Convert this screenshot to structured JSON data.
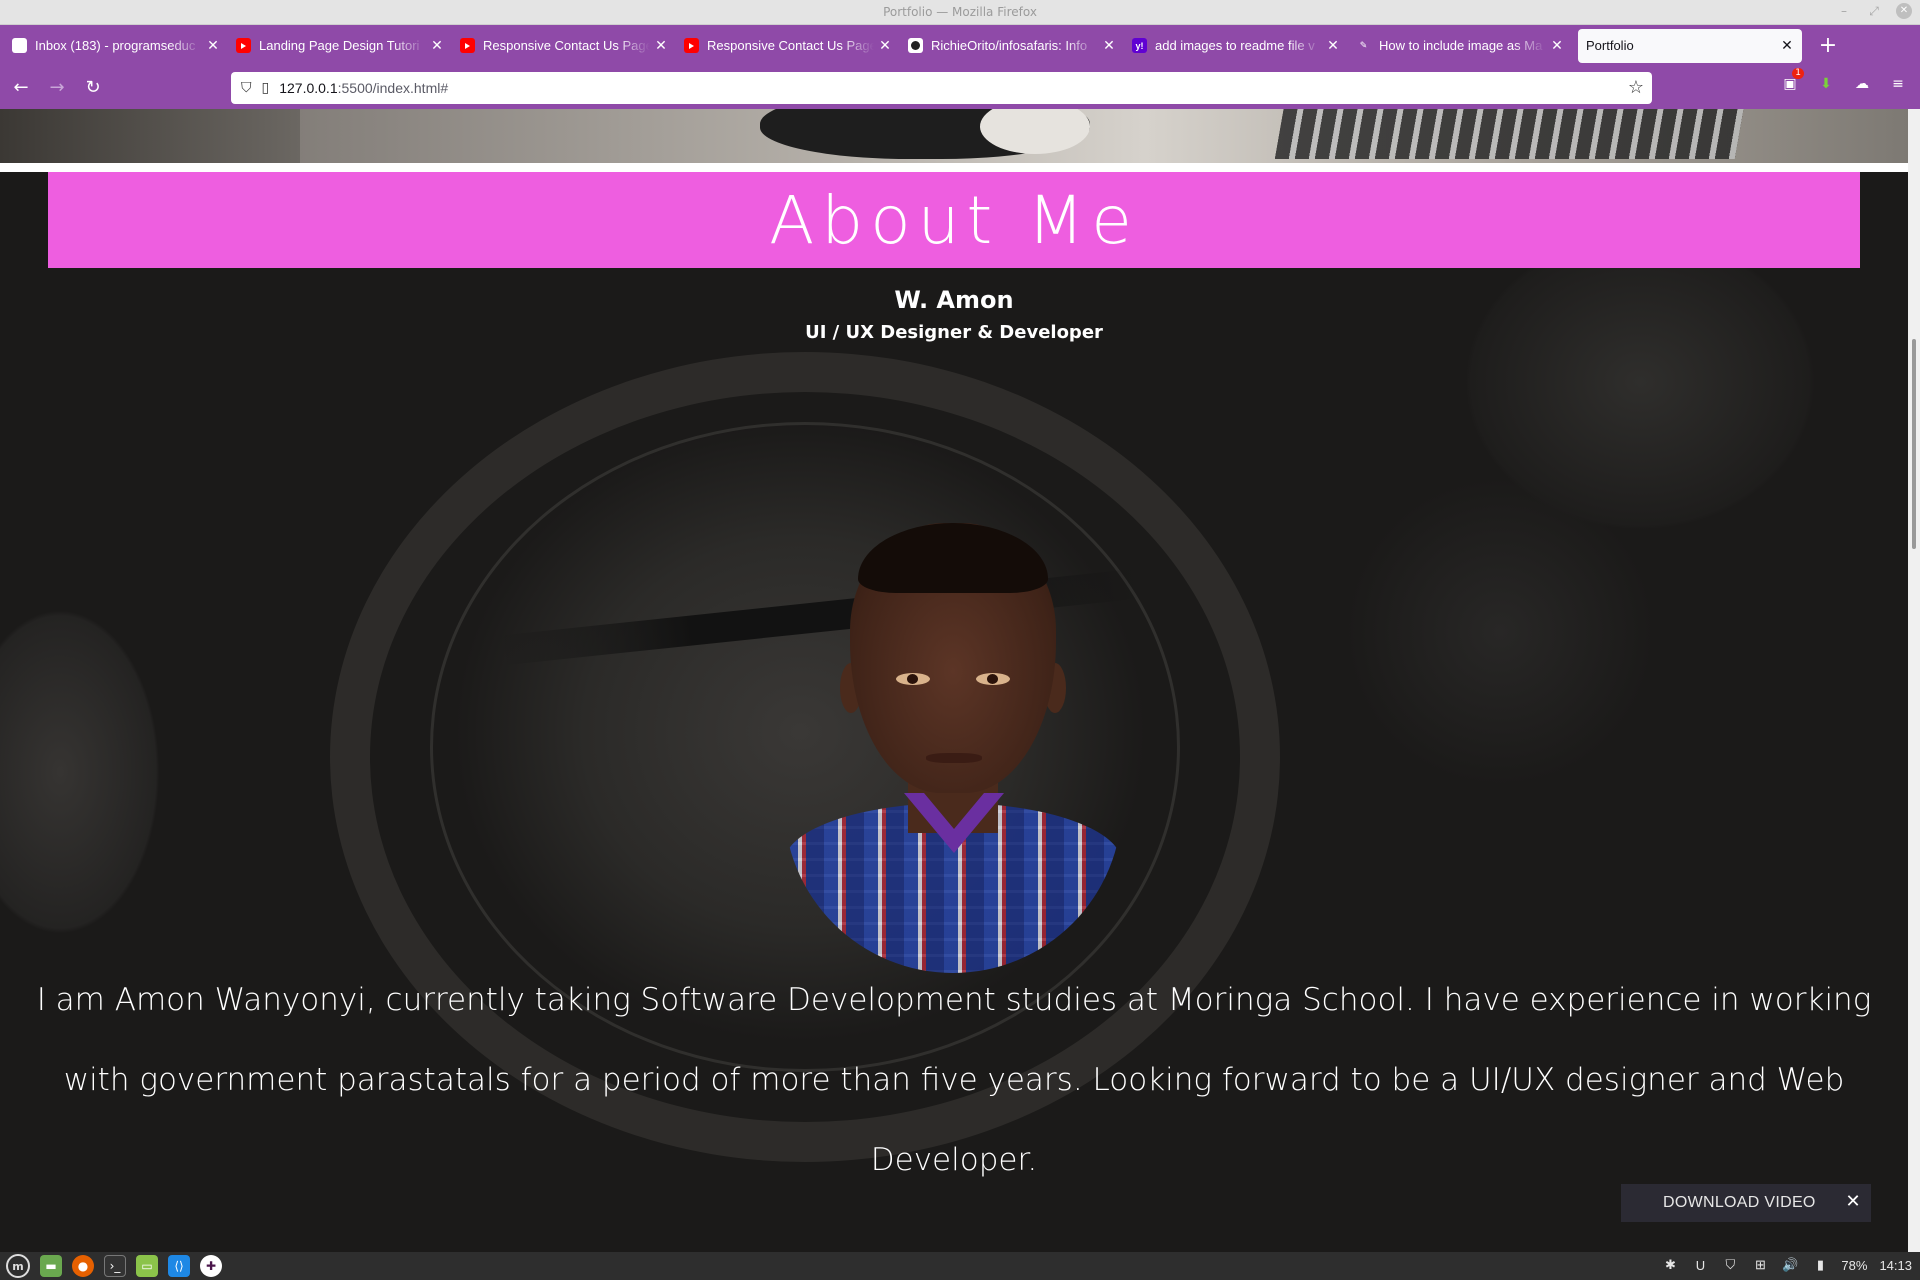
{
  "window": {
    "title": "Portfolio — Mozilla Firefox"
  },
  "tabs": [
    {
      "label": "Inbox (183) - programseduc",
      "icon": "gmail-icon"
    },
    {
      "label": "Landing Page Design Tutori",
      "icon": "youtube-icon"
    },
    {
      "label": "Responsive Contact Us Page",
      "icon": "youtube-icon"
    },
    {
      "label": "Responsive Contact Us Page",
      "icon": "youtube-icon"
    },
    {
      "label": "RichieOrito/infosafaris: Info",
      "icon": "github-icon"
    },
    {
      "label": "add images to readme file v",
      "icon": "yahoo-icon"
    },
    {
      "label": "How to include image as Ma",
      "icon": "markdown-icon"
    },
    {
      "label": "Portfolio",
      "icon": "none",
      "active": true
    }
  ],
  "urlbar": {
    "host": "127.0.0.1",
    "rest": ":5500/index.html#"
  },
  "extensions": {
    "badge": "1"
  },
  "page": {
    "section_title": "About Me",
    "name": "W. Amon",
    "role": "UI / UX Designer & Developer",
    "bio": "I am Amon Wanyonyi, currently taking Software Development studies at Moringa School. I have experience in working with government parastatals for a period of more than five years. Looking forward to be a UI/UX designer and Web Developer.",
    "banner_color": "#ee5ee0"
  },
  "download_popup": {
    "label": "DOWNLOAD VIDEO"
  },
  "taskbar": {
    "battery": "78%",
    "clock": "14:13"
  },
  "colors": {
    "browser_chrome": "#8f4aa8",
    "taskbar": "#2e2e2e"
  }
}
